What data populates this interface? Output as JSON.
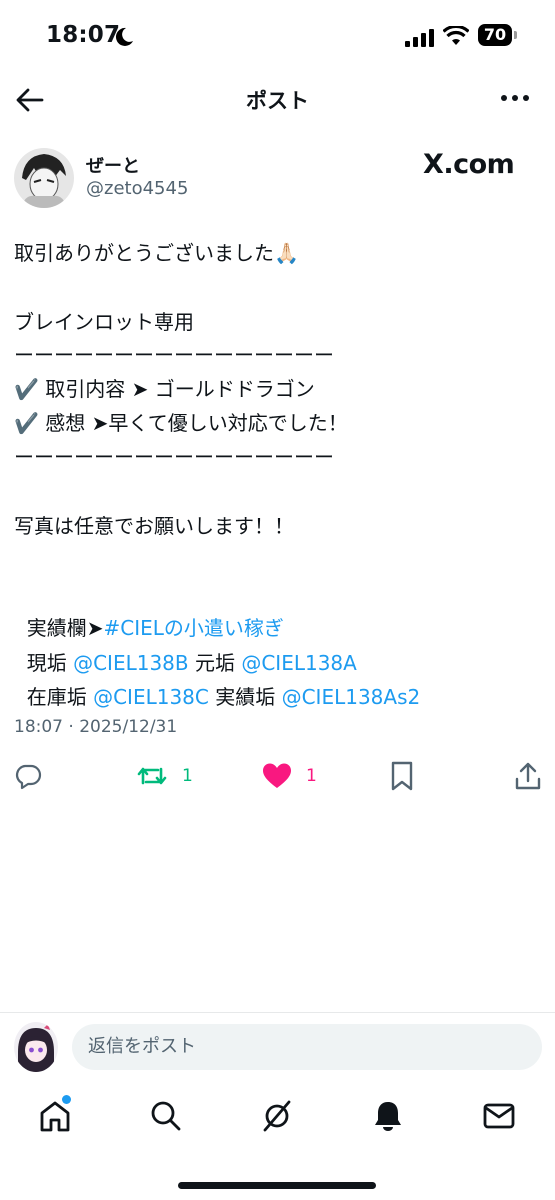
{
  "status_bar": {
    "time": "18:07",
    "battery": "70"
  },
  "header": {
    "title": "ポスト"
  },
  "author": {
    "name": "ぜーと",
    "handle": "@zeto4545",
    "watermark": "X.com"
  },
  "post": {
    "line1": "取引ありがとうございました🙏🏻",
    "line2": "ブレインロット専用",
    "line3": "ーーーーーーーーーーーーーーーー",
    "line4": "✔️ 取引内容 ➤ ゴールドドラゴン",
    "line5": "✔️ 感想 ➤早くて優しい対応でした！",
    "line6": "ーーーーーーーーーーーーーーーー",
    "line7": "写真は任意でお願いします！！",
    "line8_prefix": "実績欄➤",
    "line8_hashtag": "#CIELの小遣い稼ぎ",
    "line9_label_a": "現垢 ",
    "line9_mention_a": "@CIEL138B",
    "line9_label_b": " 元垢 ",
    "line9_mention_b": "@CIEL138A",
    "line10_label_a": "在庫垢 ",
    "line10_mention_a": "@CIEL138C",
    "line10_label_b": " 実績垢 ",
    "line10_mention_b": "@CIEL138As2"
  },
  "timestamp": "18:07 · 2025/12/31",
  "actions": {
    "retweet_count": "1",
    "like_count": "1"
  },
  "reply_bar": {
    "placeholder": "返信をポスト"
  },
  "colors": {
    "link": "#1d9bf0",
    "retweet": "#00ba7c",
    "like": "#f91880",
    "text": "#0f1419",
    "secondary": "#536471"
  },
  "bottom_nav": [
    "home-icon",
    "search-icon",
    "grok-icon",
    "notifications-icon",
    "messages-icon"
  ]
}
